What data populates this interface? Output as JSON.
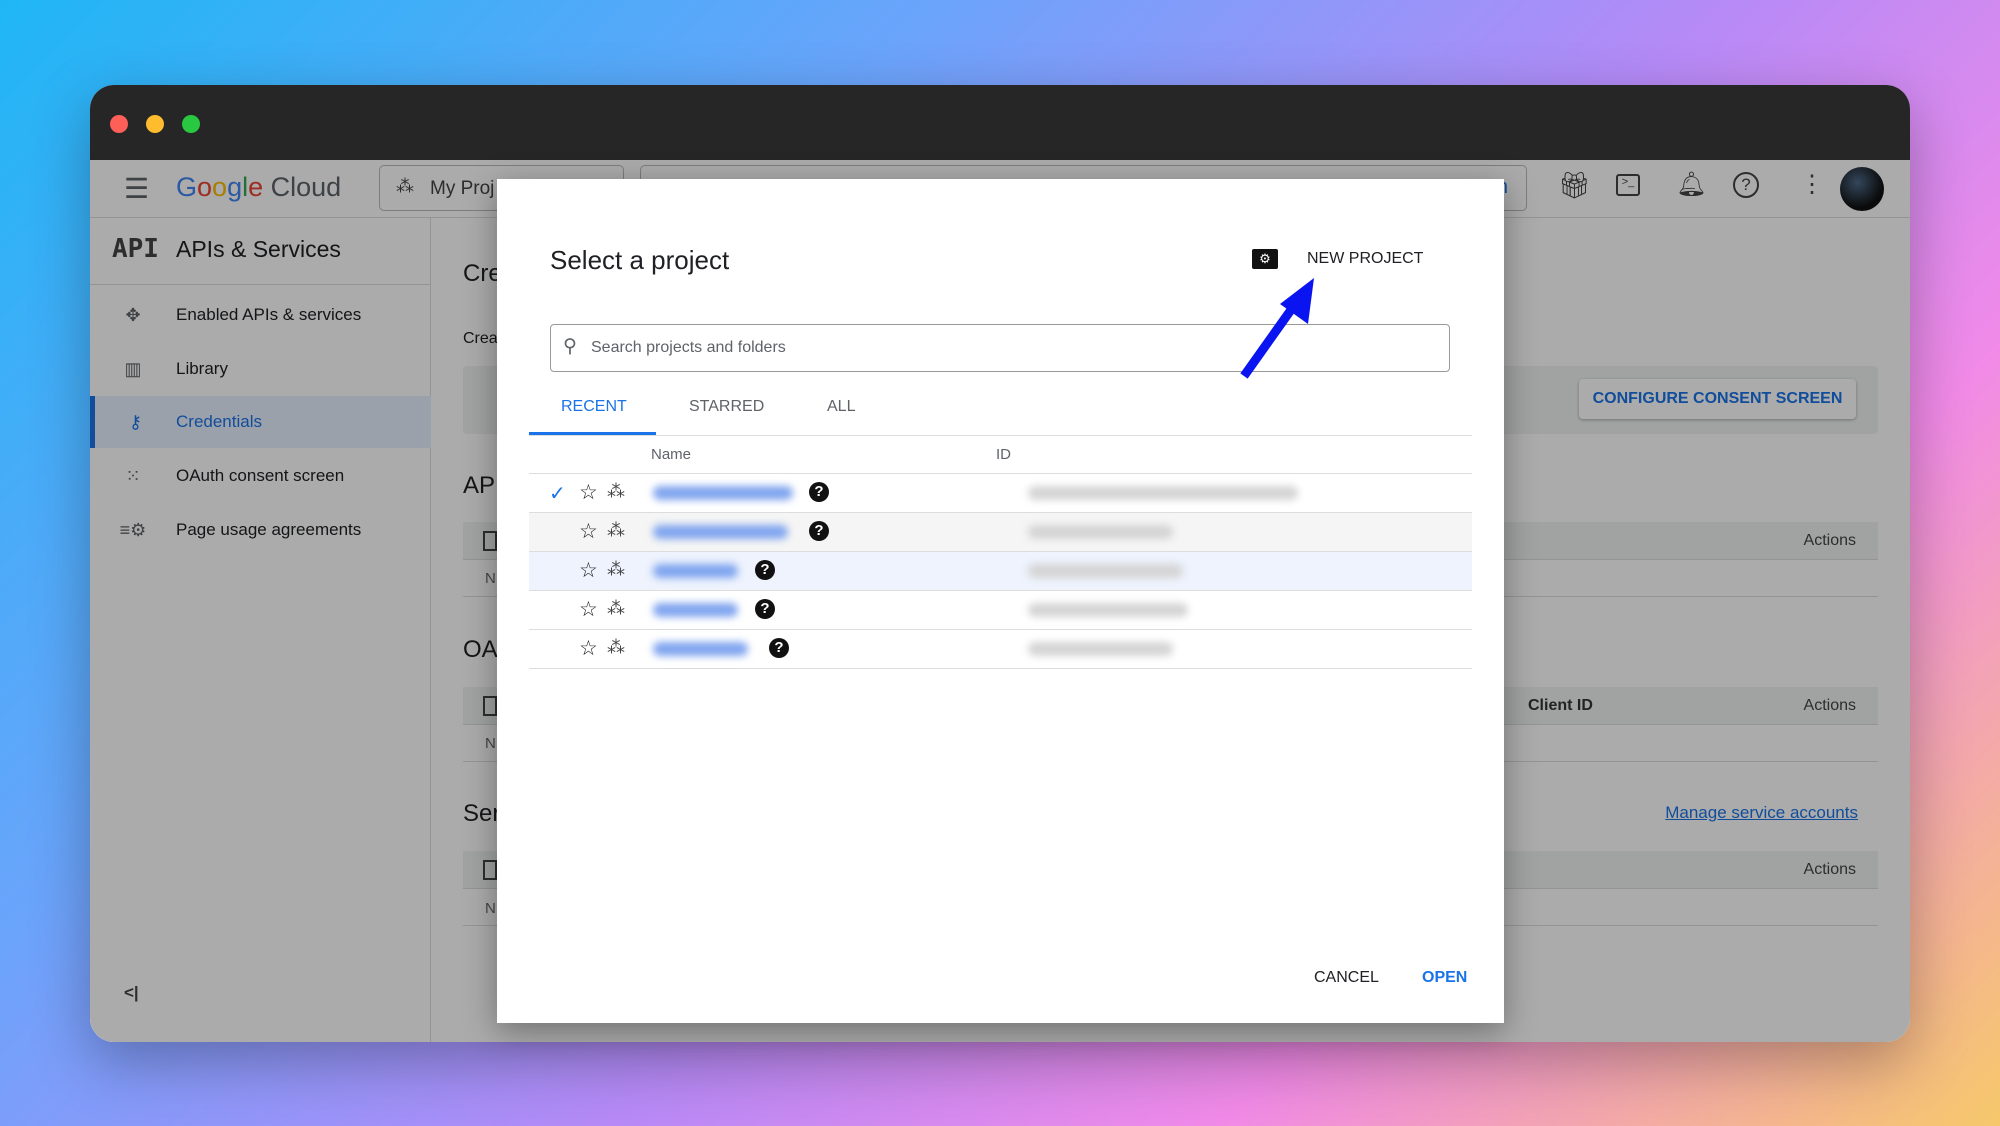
{
  "topnav": {
    "logo": "Google Cloud",
    "project_selector": "My Proj",
    "search_button_partial": "n"
  },
  "sidebar": {
    "header_logo": "API",
    "title": "APIs & Services",
    "items": [
      {
        "label": "Enabled APIs & services",
        "icon": "hub-icon"
      },
      {
        "label": "Library",
        "icon": "library-icon"
      },
      {
        "label": "Credentials",
        "icon": "key-icon",
        "selected": true
      },
      {
        "label": "OAuth consent screen",
        "icon": "consent-icon"
      },
      {
        "label": "Page usage agreements",
        "icon": "settings-list-icon"
      }
    ],
    "collapse": "<|"
  },
  "main": {
    "title_partial": "Cre",
    "subtitle_partial": "Crea",
    "configure_button": "CONFIGURE CONSENT SCREEN",
    "sections": [
      {
        "heading_partial": "AP",
        "col_left": "",
        "col_actions": "Actions",
        "empty_partial": "N"
      },
      {
        "heading_partial": "OA",
        "col_client": "Client ID",
        "col_actions": "Actions",
        "empty_partial": "N"
      },
      {
        "heading_partial": "Ser",
        "link": "Manage service accounts",
        "col_actions": "Actions",
        "empty_partial": "N"
      }
    ]
  },
  "dialog": {
    "title": "Select a project",
    "new_project": "NEW PROJECT",
    "search_placeholder": "Search projects and folders",
    "tabs": [
      {
        "label": "RECENT",
        "active": true
      },
      {
        "label": "STARRED"
      },
      {
        "label": "ALL"
      }
    ],
    "columns": {
      "name": "Name",
      "id": "ID"
    },
    "rows": [
      {
        "checked": true
      },
      {
        "checked": false
      },
      {
        "checked": false,
        "highlight": true
      },
      {
        "checked": false
      },
      {
        "checked": false
      }
    ],
    "cancel": "CANCEL",
    "open": "OPEN"
  },
  "colors": {
    "accent": "#1a73e8",
    "annotation_arrow": "#0a14f0"
  }
}
